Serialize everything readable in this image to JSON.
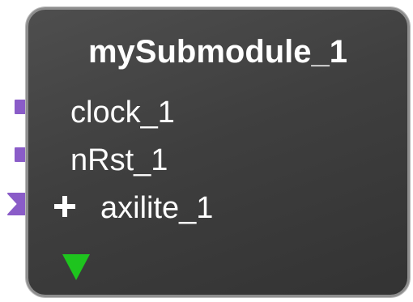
{
  "block": {
    "title": "mySubmodule_1",
    "ports": [
      {
        "label": "clock_1",
        "type": "single"
      },
      {
        "label": "nRst_1",
        "type": "single"
      },
      {
        "label": "axilite_1",
        "type": "bus",
        "expandable": true
      }
    ],
    "icons": {
      "port_connector": "port-connector-icon",
      "bus_connector": "bus-connector-icon",
      "expand": "plus-icon",
      "collapse": "triangle-down-icon"
    },
    "colors": {
      "background": "#3f3f3f",
      "border": "#8e8e8e",
      "text": "#ffffff",
      "port": "#8a5cc8",
      "collapse_arrow": "#1ec41e"
    }
  }
}
